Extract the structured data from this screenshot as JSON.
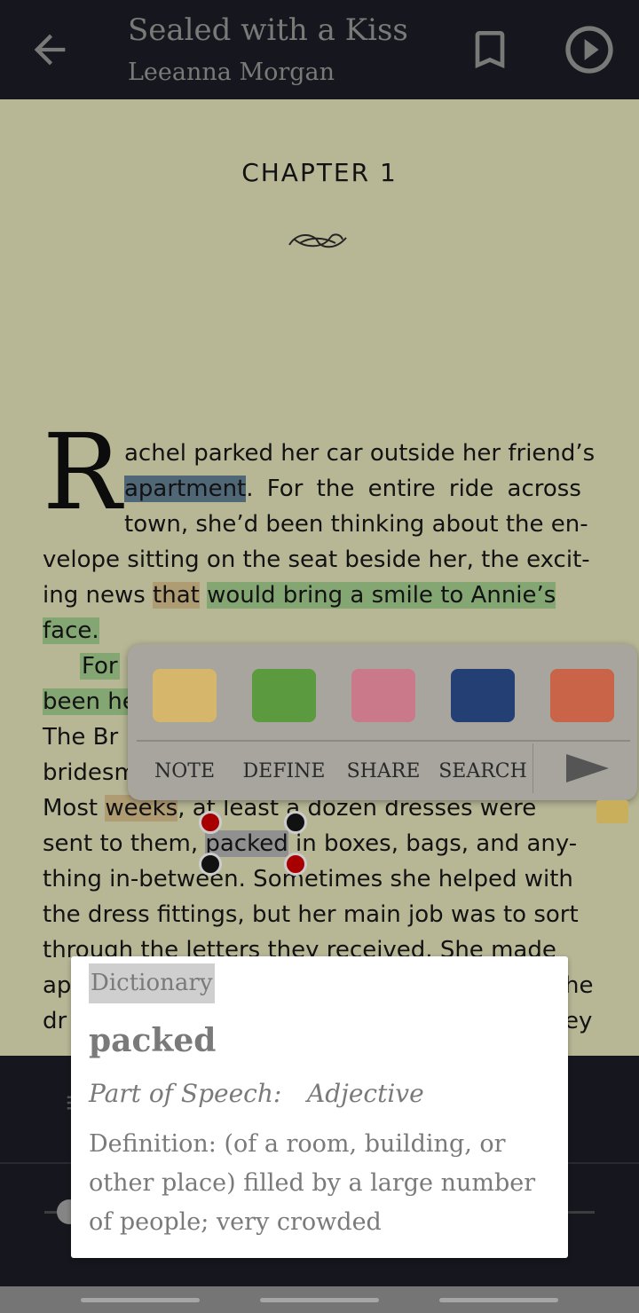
{
  "header": {
    "title": "Sealed with a Kiss",
    "author": "Leeanna Morgan"
  },
  "reader": {
    "chapter": "CHAPTER 1",
    "dropcap": "R",
    "paragraph1": {
      "l1": "achel parked her car outside her friend’s",
      "l2_highlight": "apartment",
      "l2_rest": ". For the entire ride across",
      "l3": "town, she’d been thinking about the en-",
      "l4": "velope sitting on the seat beside her, the excit-",
      "l5_a": "ing news ",
      "l5_orange": "that",
      "l5_b": " ",
      "l5_green": "would bring a smile to Annie’s",
      "l6_green": "face."
    },
    "paragraph2": {
      "l1_indent": "For",
      "l2_green": "been he",
      "l3": "The Br",
      "l4": "bridesm",
      "l5_a": "Most ",
      "l5_orange": "weeks",
      "l5_b": ", at least a dozen dresses were",
      "l6_a": "sent to them, ",
      "l6_gray": "packed",
      "l6_b": " in boxes, bags, and any-",
      "l7": "thing in-between. Sometimes she helped with",
      "l8": "the dress fittings, but her main job was to sort",
      "l9": "through the letters they received. She made",
      "l10_a": "ap",
      "l10_b": "he",
      "l11_a": "dr",
      "l11_b": "ey"
    }
  },
  "selection_popup": {
    "colors": {
      "yellow": "#d5b66a",
      "green": "#5c9a40",
      "pink": "#c9798a",
      "blue": "#233f73",
      "orange": "#c96448"
    },
    "actions": [
      "NOTE",
      "DEFINE",
      "SHARE",
      "SEARCH"
    ],
    "next_icon": "play-arrow-icon"
  },
  "dictionary": {
    "header": "Dictionary",
    "word": "packed",
    "pos_label": "Part of Speech:",
    "pos_value": "Adjective",
    "definition": "Definition:  (of a room, building, or other place) filled by a large number of people; very crowded"
  }
}
